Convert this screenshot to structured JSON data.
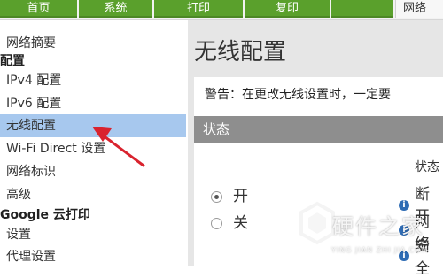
{
  "tabs": {
    "home": "首页",
    "system": "系统",
    "print": "打印",
    "copy": "复印",
    "network": "网络"
  },
  "sidebar": {
    "items": [
      {
        "label": "网络摘要"
      },
      {
        "label": "配置"
      },
      {
        "label": "IPv4 配置"
      },
      {
        "label": "IPv6 配置"
      },
      {
        "label": "无线配置"
      },
      {
        "label": "Wi-Fi Direct 设置"
      },
      {
        "label": "网络标识"
      },
      {
        "label": "高级"
      },
      {
        "label": "Google 云打印"
      },
      {
        "label": "设置"
      },
      {
        "label": "代理设置"
      }
    ]
  },
  "main": {
    "title": "无线配置",
    "warning": "警告：在更改无线设置时，一定要",
    "status_header": "状态",
    "status_label": "状态",
    "status_value": "断开",
    "radio_on": "开",
    "radio_off": "关",
    "side_text_1": "网络",
    "side_text_2": "安全"
  },
  "watermark": {
    "title": "硬件之家",
    "subtitle": "YING JIAN ZHI JIA.COM"
  },
  "colors": {
    "tab_green": "#5aa02c",
    "active_item": "#a7c8ee",
    "status_bar": "#8e8e8e",
    "arrow": "#d9232e"
  },
  "icons": {
    "info": "info-icon",
    "arrow": "pointer-arrow-icon",
    "watermark_logo": "hexagon-logo-icon"
  }
}
